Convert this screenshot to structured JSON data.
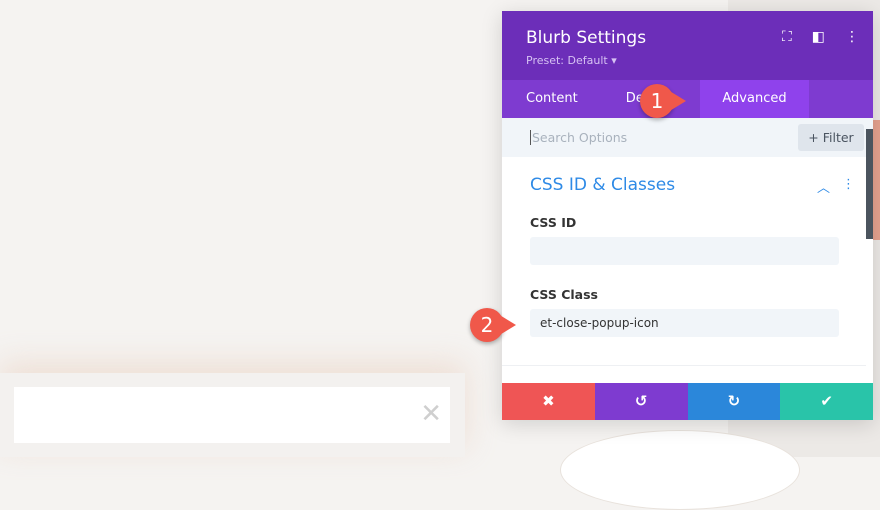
{
  "panel": {
    "title": "Blurb Settings",
    "preset": "Preset: Default ▾",
    "tabs": [
      "Content",
      "Design",
      "Advanced"
    ],
    "search_placeholder": "Search Options",
    "filter": "+ Filter",
    "section": "CSS ID & Classes",
    "css_id_label": "CSS ID",
    "css_id_value": "",
    "css_class_label": "CSS Class",
    "css_class_value": "et-close-popup-icon"
  },
  "markers": [
    "1",
    "2"
  ],
  "colors": {
    "header": "#6c2eb9",
    "tabs": "#7e3bd0",
    "active_tab": "#8f42ec",
    "cancel": "#ef5555",
    "undo": "#7e3bd0",
    "redo": "#2b87da",
    "save": "#29c4a9"
  }
}
